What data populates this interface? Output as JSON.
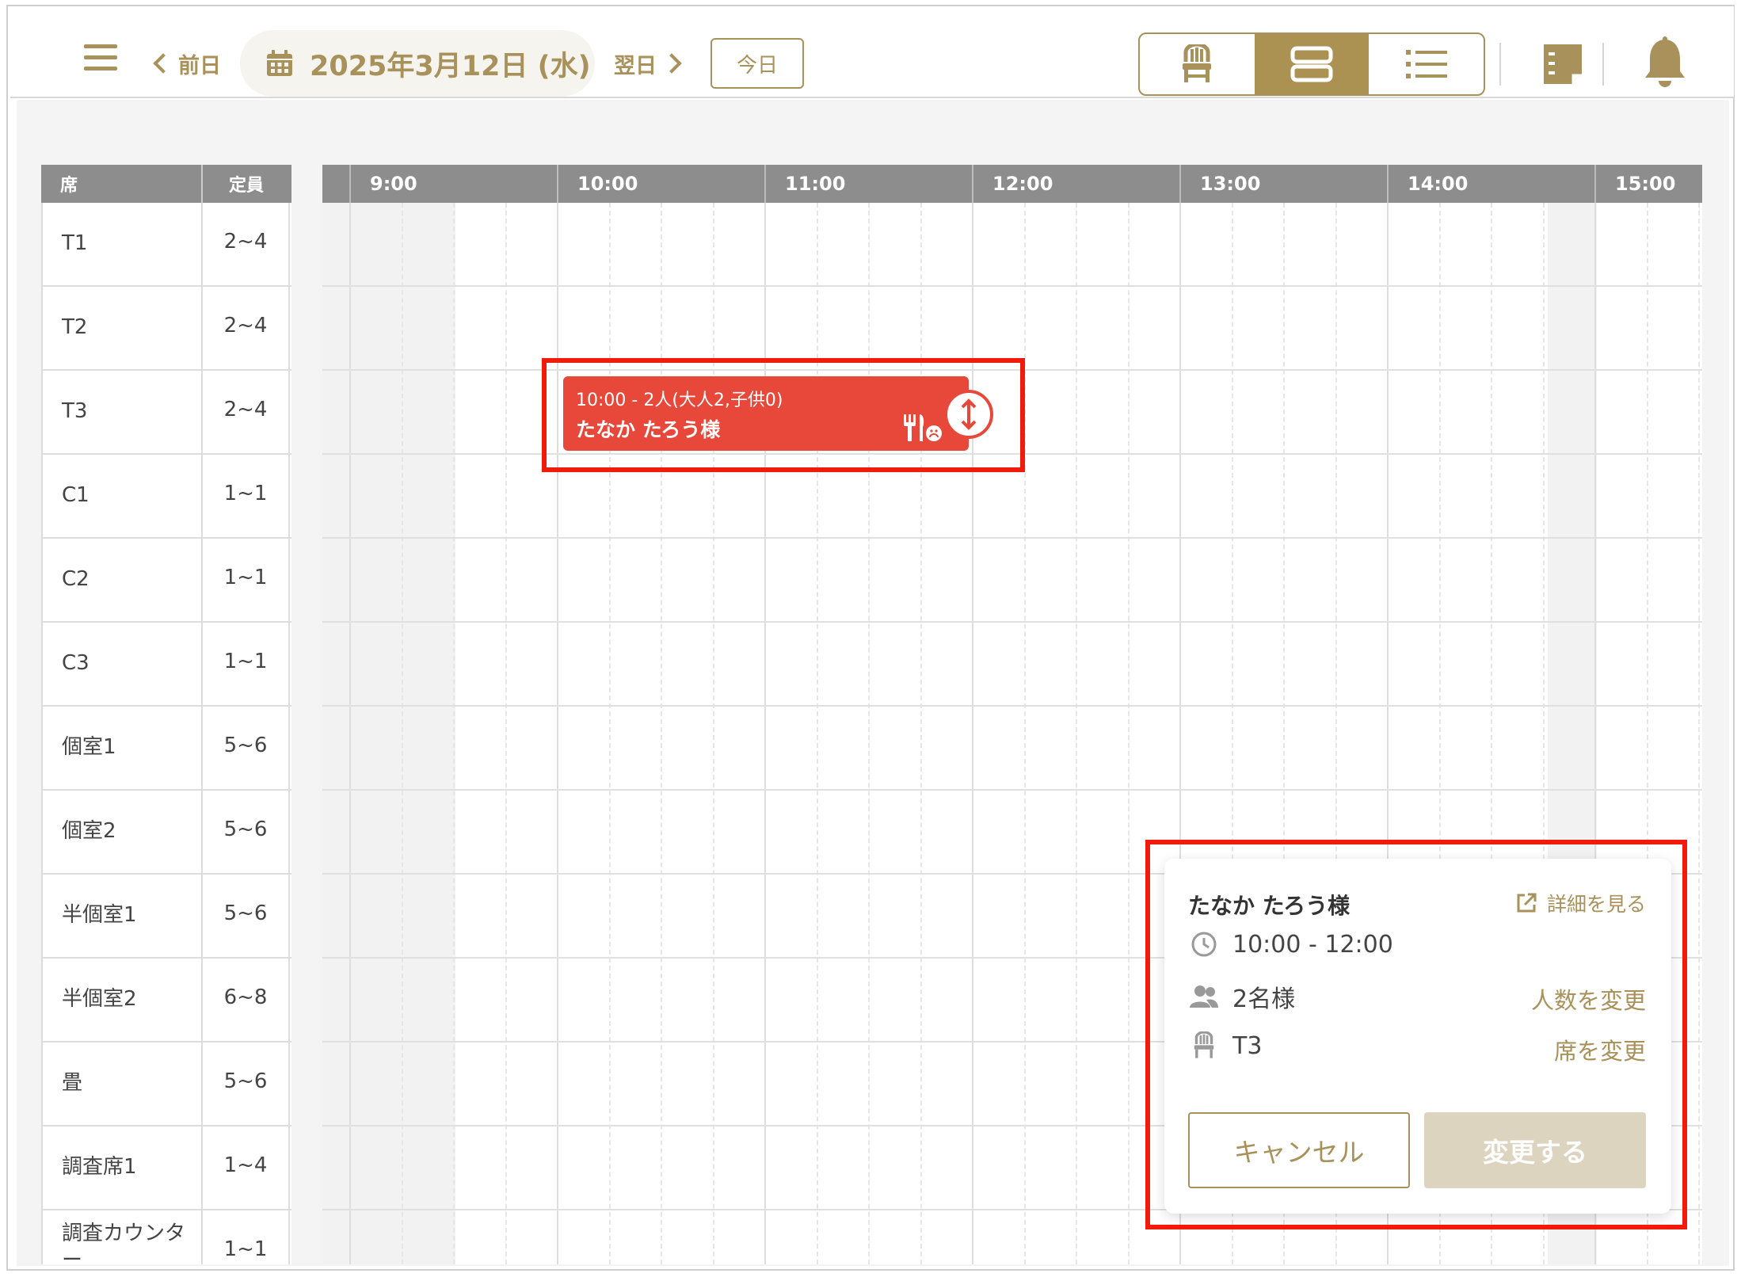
{
  "header": {
    "prev_label": "前日",
    "next_label": "翌日",
    "date": "2025年3月12日 (水)",
    "today_label": "今日"
  },
  "seat_table": {
    "col_seat": "席",
    "col_capacity": "定員",
    "rows": [
      {
        "name": "T1",
        "capacity": "2~4"
      },
      {
        "name": "T2",
        "capacity": "2~4"
      },
      {
        "name": "T3",
        "capacity": "2~4"
      },
      {
        "name": "C1",
        "capacity": "1~1"
      },
      {
        "name": "C2",
        "capacity": "1~1"
      },
      {
        "name": "C3",
        "capacity": "1~1"
      },
      {
        "name": "個室1",
        "capacity": "5~6"
      },
      {
        "name": "個室2",
        "capacity": "5~6"
      },
      {
        "name": "半個室1",
        "capacity": "5~6"
      },
      {
        "name": "半個室2",
        "capacity": "6~8"
      },
      {
        "name": "畳",
        "capacity": "5~6"
      },
      {
        "name": "調査席1",
        "capacity": "1~4"
      },
      {
        "name": "調査カウンター",
        "capacity": "1~1"
      }
    ]
  },
  "timeline": {
    "hours": [
      "9:00",
      "10:00",
      "11:00",
      "12:00",
      "13:00",
      "14:00",
      "15:00"
    ]
  },
  "reservation": {
    "summary": "10:00 - 2人(大人2,子供0)",
    "guest": "たなか たろう様"
  },
  "popup": {
    "guest": "たなか たろう様",
    "detail_link": "詳細を見る",
    "time": "10:00 - 12:00",
    "people": "2名様",
    "people_link": "人数を変更",
    "seat": "T3",
    "seat_link": "席を変更",
    "cancel_label": "キャンセル",
    "submit_label": "変更する"
  },
  "colors": {
    "accent": "#a8915a",
    "reservation": "#e8483a",
    "highlight": "#f01b0b"
  },
  "icons": {
    "menu": "hamburger-icon",
    "calendar": "calendar-icon",
    "seat_view": "chair-icon",
    "timeline_view": "timeline-icon",
    "list_view": "list-icon",
    "memo": "memo-icon",
    "notification": "bell-icon"
  }
}
